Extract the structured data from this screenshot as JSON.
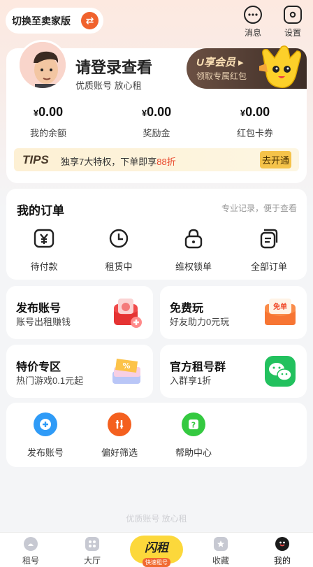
{
  "header": {
    "switch_label": "切换至卖家版",
    "messages_label": "消息",
    "settings_label": "设置"
  },
  "profile": {
    "login_title": "请登录查看",
    "login_sub": "优质账号 放心租",
    "vip_title": "U享会员",
    "vip_sub": "领取专属红包",
    "stats": [
      {
        "currency": "¥",
        "value": "0.00",
        "label": "我的余额"
      },
      {
        "currency": "¥",
        "value": "0.00",
        "label": "奖励金"
      },
      {
        "currency": "¥",
        "value": "0.00",
        "label": "红包卡券"
      }
    ],
    "tips": {
      "tag": "TIPS",
      "text_a": "独享7大特权，下单即享",
      "text_b": "88折",
      "button": "去开通"
    }
  },
  "orders": {
    "title": "我的订单",
    "subtitle": "专业记录，便于查看",
    "items": [
      {
        "label": "待付款",
        "icon": "yen-payment-icon"
      },
      {
        "label": "租赁中",
        "icon": "clock-icon"
      },
      {
        "label": "维权锁单",
        "icon": "lock-icon"
      },
      {
        "label": "全部订单",
        "icon": "order-list-icon"
      }
    ]
  },
  "features": [
    {
      "title": "发布账号",
      "sub": "账号出租赚钱",
      "icon": "red-envelope-icon"
    },
    {
      "title": "免费玩",
      "sub": "好友助力0元玩",
      "icon": "free-coupon-icon"
    },
    {
      "title": "特价专区",
      "sub": "热门游戏0.1元起",
      "icon": "discount-ticket-icon"
    },
    {
      "title": "官方租号群",
      "sub": "入群享1折",
      "icon": "wechat-icon"
    }
  ],
  "tools": [
    {
      "label": "发布账号",
      "icon": "plus-circle-icon",
      "color": "#2f9bf7"
    },
    {
      "label": "偏好筛选",
      "icon": "filter-icon",
      "color": "#f4601f"
    },
    {
      "label": "帮助中心",
      "icon": "help-icon",
      "color": "#34c940"
    }
  ],
  "slogan": "优质账号 放心租",
  "tabbar": {
    "items": [
      {
        "label": "租号",
        "icon": "rent-icon"
      },
      {
        "label": "大厅",
        "icon": "hall-grid-icon"
      },
      {
        "label": "收藏",
        "icon": "star-icon"
      },
      {
        "label": "我的",
        "icon": "profile-icon"
      }
    ],
    "center_title": "闪租",
    "center_sub": "快速租号"
  },
  "colors": {
    "accent": "#f0622d",
    "vip_gold": "#fbe0b5",
    "tips_red": "#e8472b",
    "center_yellow": "#fcd83b"
  }
}
